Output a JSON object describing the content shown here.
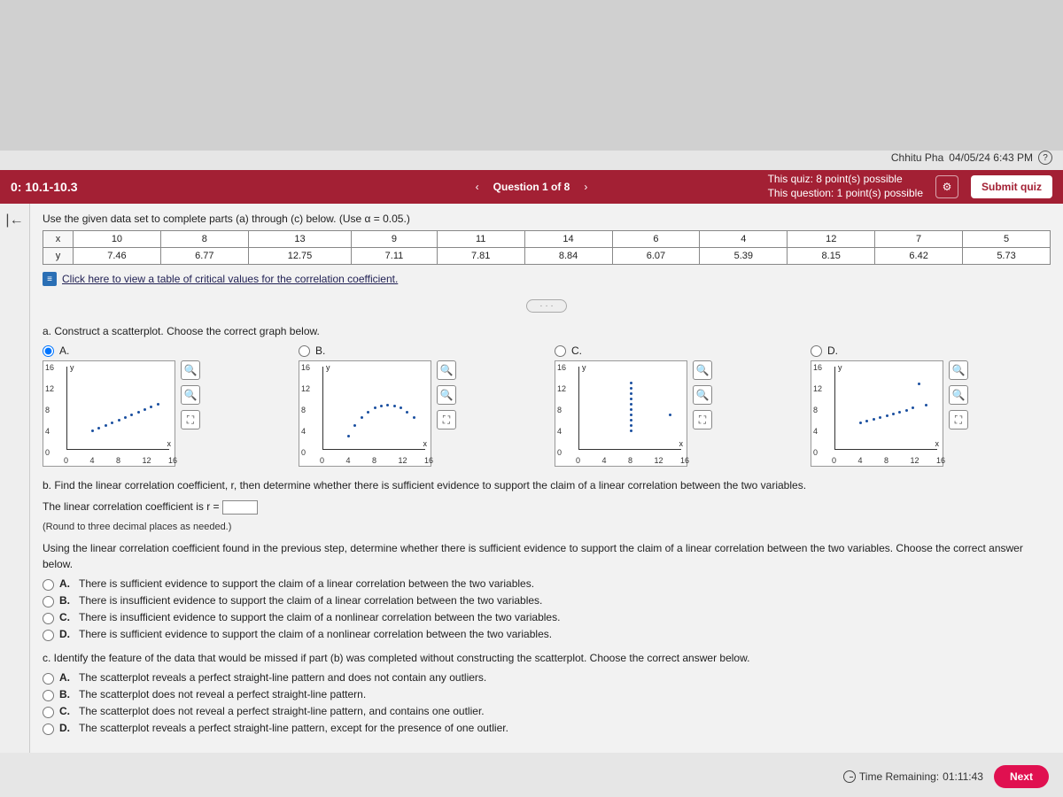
{
  "user": {
    "name": "Chhitu Pha",
    "datetime": "04/05/24 6:43 PM"
  },
  "header": {
    "section": "0: 10.1-10.3",
    "prev": "‹",
    "qlabel": "Question 1 of 8",
    "next": "›",
    "quiz_points": "This quiz: 8 point(s) possible",
    "question_points": "This question: 1 point(s) possible",
    "submit": "Submit quiz"
  },
  "instruction": "Use the given data set to complete parts (a) through (c) below. (Use α = 0.05.)",
  "table": {
    "rows": [
      {
        "h": "x",
        "cells": [
          "10",
          "8",
          "13",
          "9",
          "11",
          "14",
          "6",
          "4",
          "12",
          "7",
          "5"
        ]
      },
      {
        "h": "y",
        "cells": [
          "7.46",
          "6.77",
          "12.75",
          "7.11",
          "7.81",
          "8.84",
          "6.07",
          "5.39",
          "8.15",
          "6.42",
          "5.73"
        ]
      }
    ]
  },
  "link_text": "Click here to view a table of critical values for the correlation coefficient.",
  "pill": "· · ·",
  "part_a": "a. Construct a scatterplot. Choose the correct graph below.",
  "choice_labels": [
    "A.",
    "B.",
    "C.",
    "D."
  ],
  "tool": {
    "zoom_in": "🔍",
    "zoom_out": "🔍",
    "expand": "⛶"
  },
  "plot_ticks_y": [
    "16",
    "12",
    "8",
    "4",
    "0"
  ],
  "plot_ticks_x": [
    "0",
    "4",
    "8",
    "12",
    "16"
  ],
  "axis_y": "y",
  "axis_x": "x",
  "part_b_intro": "b. Find the linear correlation coefficient, r, then determine whether there is sufficient evidence to support the claim of a linear correlation between the two variables.",
  "part_b_line1_pre": "The linear correlation coefficient is r = ",
  "part_b_round": "(Round to three decimal places as needed.)",
  "part_b_line2": "Using the linear correlation coefficient found in the previous step, determine whether there is sufficient evidence to support the claim of a linear correlation between the two variables. Choose the correct answer below.",
  "b_options": [
    "There is sufficient evidence to support the claim of a linear correlation between the two variables.",
    "There is insufficient evidence to support the claim of a linear correlation between the two variables.",
    "There is insufficient evidence to support the claim of a nonlinear correlation between the two variables.",
    "There is sufficient evidence to support the claim of a nonlinear correlation between the two variables."
  ],
  "part_c_intro": "c. Identify the feature of the data that would be missed if part (b) was completed without constructing the scatterplot. Choose the correct answer below.",
  "c_options": [
    "The scatterplot reveals a perfect straight-line pattern and does not contain any outliers.",
    "The scatterplot does not reveal a perfect straight-line pattern.",
    "The scatterplot does not reveal a perfect straight-line pattern, and contains one outlier.",
    "The scatterplot reveals a perfect straight-line pattern, except for the presence of one outlier."
  ],
  "opt_labels": [
    "A.",
    "B.",
    "C.",
    "D."
  ],
  "footer": {
    "time_label": "Time Remaining:",
    "time_value": "01:11:43",
    "next": "Next"
  },
  "chart_data": [
    {
      "type": "scatter",
      "label": "A",
      "xlim": [
        0,
        16
      ],
      "ylim": [
        0,
        16
      ],
      "points": [
        [
          4,
          4
        ],
        [
          5,
          4.5
        ],
        [
          6,
          5
        ],
        [
          7,
          5.5
        ],
        [
          8,
          6
        ],
        [
          9,
          6.5
        ],
        [
          10,
          7
        ],
        [
          11,
          7.5
        ],
        [
          12,
          8
        ],
        [
          13,
          8.5
        ],
        [
          14,
          9
        ]
      ]
    },
    {
      "type": "scatter",
      "label": "B",
      "xlim": [
        0,
        16
      ],
      "ylim": [
        0,
        16
      ],
      "points": [
        [
          4,
          3
        ],
        [
          5,
          5
        ],
        [
          6,
          6.5
        ],
        [
          7,
          7.5
        ],
        [
          8,
          8.2
        ],
        [
          9,
          8.6
        ],
        [
          10,
          8.8
        ],
        [
          11,
          8.6
        ],
        [
          12,
          8.2
        ],
        [
          13,
          7.5
        ],
        [
          14,
          6.5
        ]
      ]
    },
    {
      "type": "scatter",
      "label": "C",
      "xlim": [
        0,
        16
      ],
      "ylim": [
        0,
        16
      ],
      "points": [
        [
          8,
          4
        ],
        [
          8,
          5
        ],
        [
          8,
          6
        ],
        [
          8,
          7
        ],
        [
          8,
          8
        ],
        [
          8,
          9
        ],
        [
          8,
          10
        ],
        [
          8,
          11
        ],
        [
          8,
          12
        ],
        [
          8,
          13
        ],
        [
          14,
          7
        ]
      ]
    },
    {
      "type": "scatter",
      "label": "D",
      "xlim": [
        0,
        16
      ],
      "ylim": [
        0,
        16
      ],
      "points": [
        [
          4,
          5.4
        ],
        [
          5,
          5.7
        ],
        [
          6,
          6.1
        ],
        [
          7,
          6.4
        ],
        [
          8,
          6.8
        ],
        [
          9,
          7.1
        ],
        [
          10,
          7.5
        ],
        [
          11,
          7.8
        ],
        [
          12,
          8.2
        ],
        [
          14,
          8.8
        ],
        [
          13,
          12.7
        ]
      ]
    }
  ]
}
